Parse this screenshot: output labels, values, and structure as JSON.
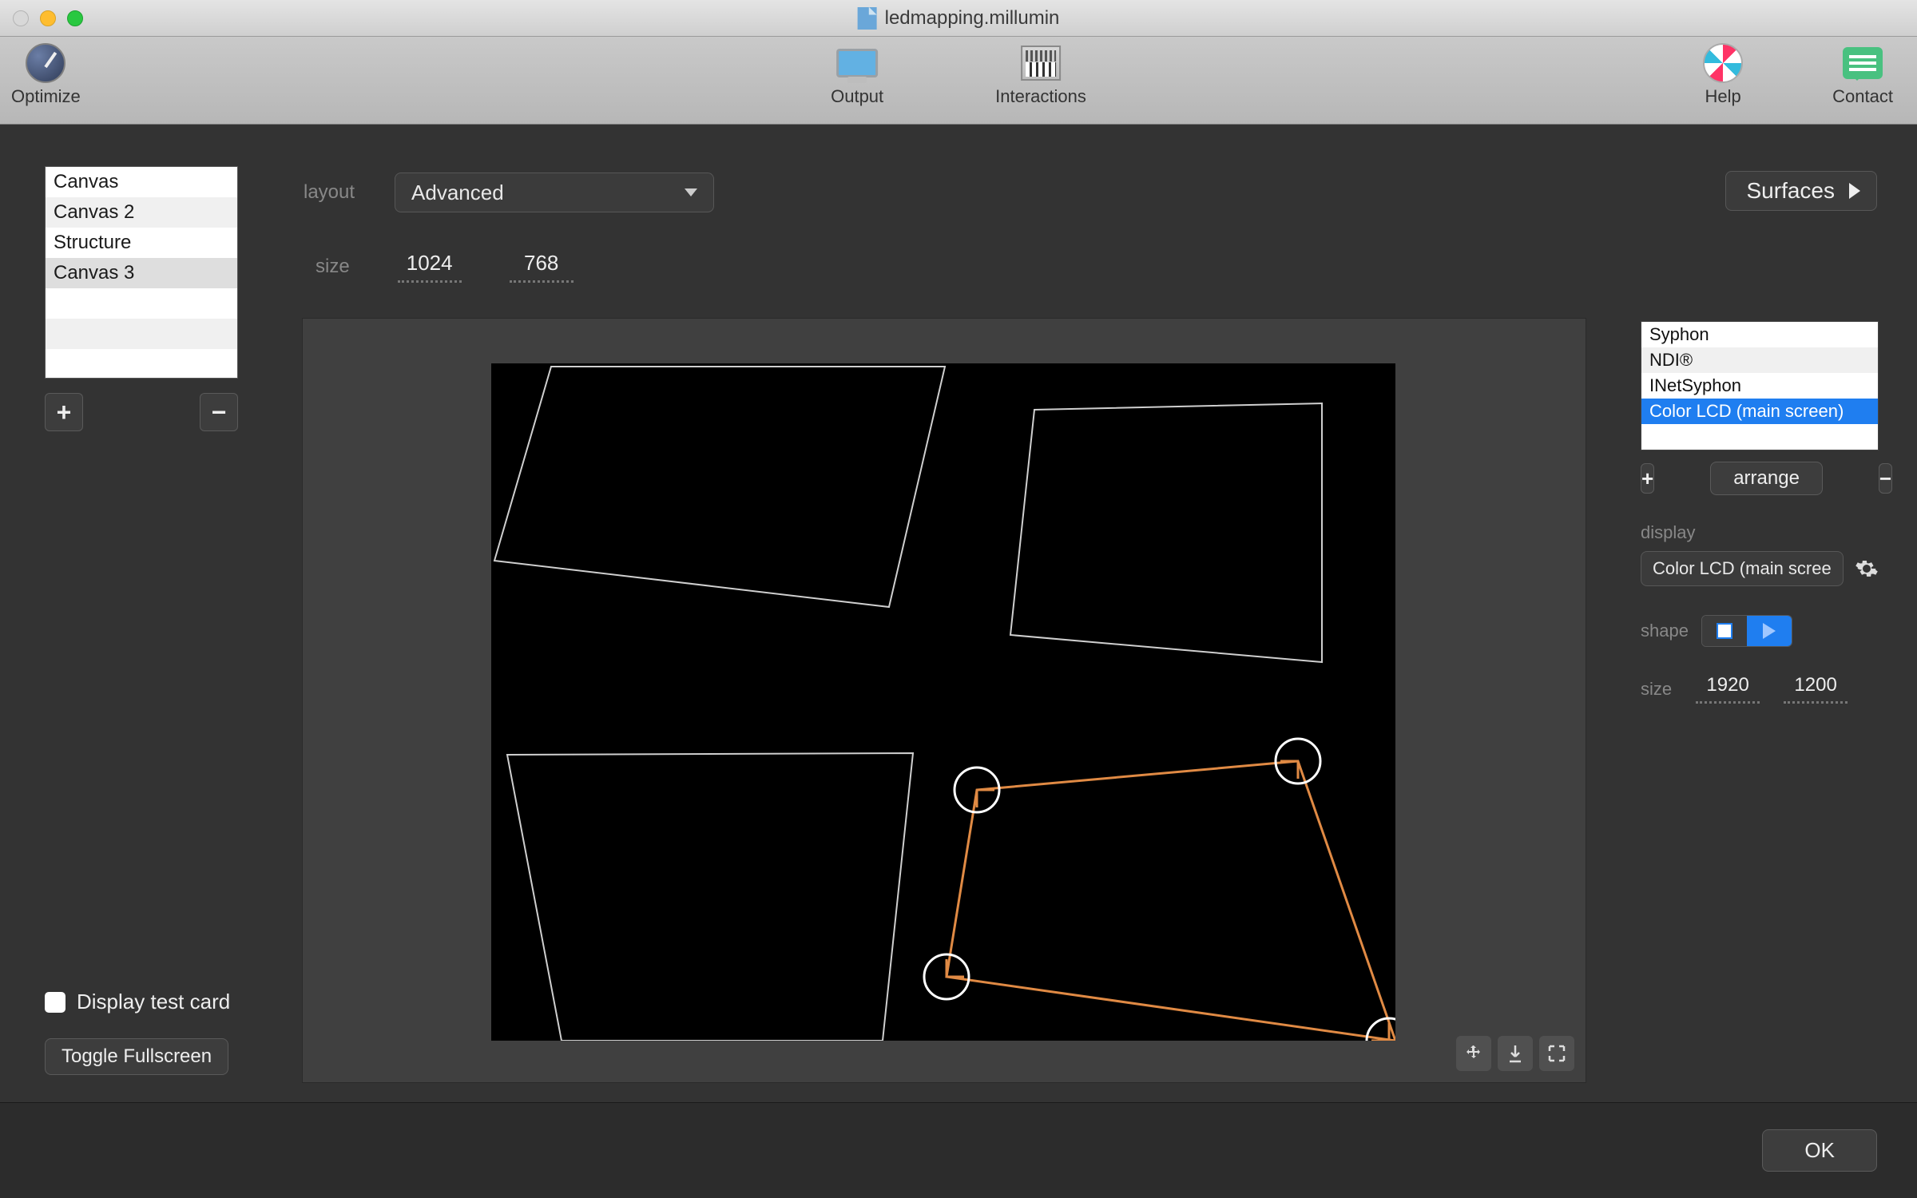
{
  "title": "ledmapping.millumin",
  "toolbar": {
    "optimize": "Optimize",
    "output": "Output",
    "interactions": "Interactions",
    "help": "Help",
    "contact": "Contact"
  },
  "leftPanel": {
    "canvases": [
      "Canvas",
      "Canvas 2",
      "Structure",
      "Canvas 3"
    ],
    "selectedIndex": 3,
    "displayTestCard": "Display test card",
    "toggleFullscreen": "Toggle Fullscreen"
  },
  "settings": {
    "layoutLabel": "layout",
    "layoutValue": "Advanced",
    "sizeLabel": "size",
    "width": "1024",
    "height": "768",
    "surfaces": "Surfaces"
  },
  "rightPanel": {
    "outputs": [
      "Syphon",
      "NDI®",
      "INetSyphon",
      "Color LCD (main screen)"
    ],
    "selectedIndex": 3,
    "arrange": "arrange",
    "displayLabel": "display",
    "displaySelected": "Color LCD (main scree",
    "shapeLabel": "shape",
    "sizeLabel": "size",
    "outWidth": "1920",
    "outHeight": "1200"
  },
  "footer": {
    "ok": "OK"
  },
  "icons": {
    "plus": "+",
    "minus": "−"
  }
}
